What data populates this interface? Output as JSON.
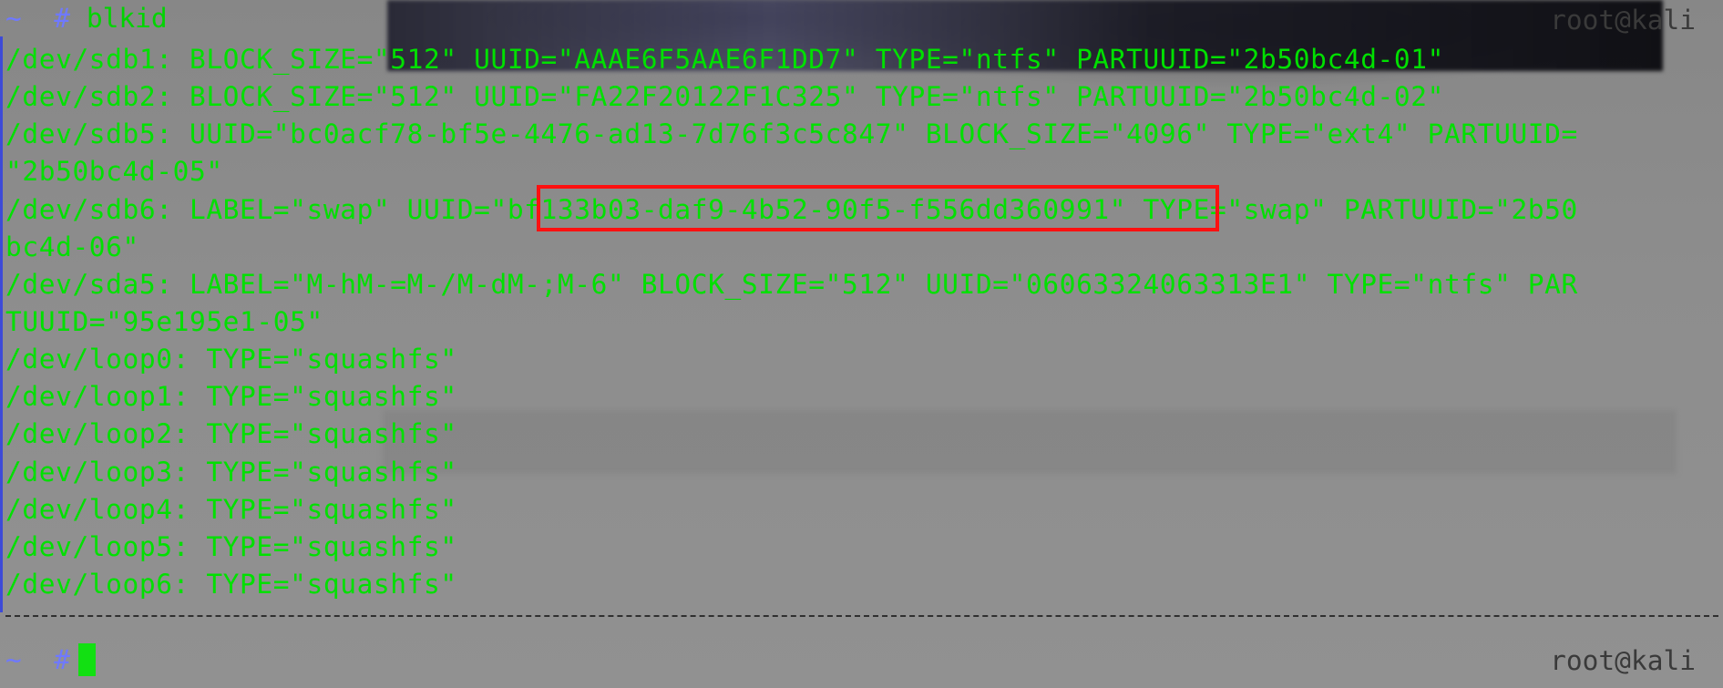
{
  "window": {
    "host": "root@kali",
    "prompt_tilde": "~",
    "prompt_hash": "#",
    "command": "blkid"
  },
  "output_lines": [
    "/dev/sdb1: BLOCK_SIZE=\"512\" UUID=\"AAAE6F5AAE6F1DD7\" TYPE=\"ntfs\" PARTUUID=\"2b50bc4d-01\"",
    "/dev/sdb2: BLOCK_SIZE=\"512\" UUID=\"FA22F20122F1C325\" TYPE=\"ntfs\" PARTUUID=\"2b50bc4d-02\"",
    "/dev/sdb5: UUID=\"bc0acf78-bf5e-4476-ad13-7d76f3c5c847\" BLOCK_SIZE=\"4096\" TYPE=\"ext4\" PARTUUID=",
    "\"2b50bc4d-05\"",
    "/dev/sdb6: LABEL=\"swap\" UUID=\"bf133b03-daf9-4b52-90f5-f556dd360991\" TYPE=\"swap\" PARTUUID=\"2b50",
    "bc4d-06\"",
    "/dev/sda5: LABEL=\"M-hM-=M-/M-dM-;M-6\" BLOCK_SIZE=\"512\" UUID=\"06063324063313E1\" TYPE=\"ntfs\" PAR",
    "TUUID=\"95e195e1-05\"",
    "/dev/loop0: TYPE=\"squashfs\"",
    "/dev/loop1: TYPE=\"squashfs\"",
    "/dev/loop2: TYPE=\"squashfs\"",
    "/dev/loop3: TYPE=\"squashfs\"",
    "/dev/loop4: TYPE=\"squashfs\"",
    "/dev/loop5: TYPE=\"squashfs\"",
    "/dev/loop6: TYPE=\"squashfs\""
  ],
  "highlight": {
    "text": "bf133b03-daf9-4b52-90f5-f556dd360991",
    "color": "#ff1010"
  },
  "colors": {
    "output_text": "#00e000",
    "prompt_symbol": "#6f79ff",
    "cursor": "#12e012",
    "host_text": "#3a3a3a"
  }
}
